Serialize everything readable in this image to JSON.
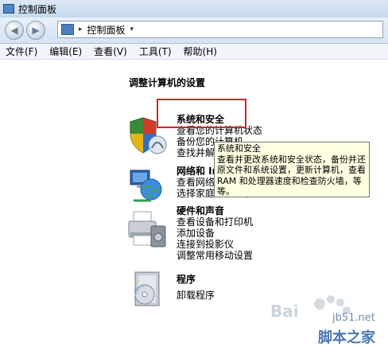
{
  "window": {
    "title": "控制面板"
  },
  "address": {
    "crumb": "控制面板",
    "separator": "▸",
    "dropdown": "▾"
  },
  "menu": [
    "文件(F)",
    "编辑(E)",
    "查看(V)",
    "工具(T)",
    "帮助(H)"
  ],
  "heading": "调整计算机的设置",
  "categories": [
    {
      "title": "系统和安全",
      "links": [
        "查看您的计算机状态",
        "备份您的计算机",
        "查找并解决问题"
      ]
    },
    {
      "title": "网络和 Internet",
      "links": [
        "查看网络状态和任务",
        "选择家庭组和共享选项"
      ]
    },
    {
      "title": "硬件和声音",
      "links": [
        "查看设备和打印机",
        "添加设备",
        "连接到投影仪",
        "调整常用移动设置"
      ]
    },
    {
      "title": "程序",
      "links": [
        "卸载程序"
      ]
    }
  ],
  "tooltip": {
    "title": "系统和安全",
    "body": "查看并更改系统和安全状态，备份并还原文件和系统设置，更新计算机，查看 RAM 和处理器速度和检查防火墙，等等。"
  },
  "watermark": {
    "site": "jb51.net",
    "name": "脚本之家"
  }
}
